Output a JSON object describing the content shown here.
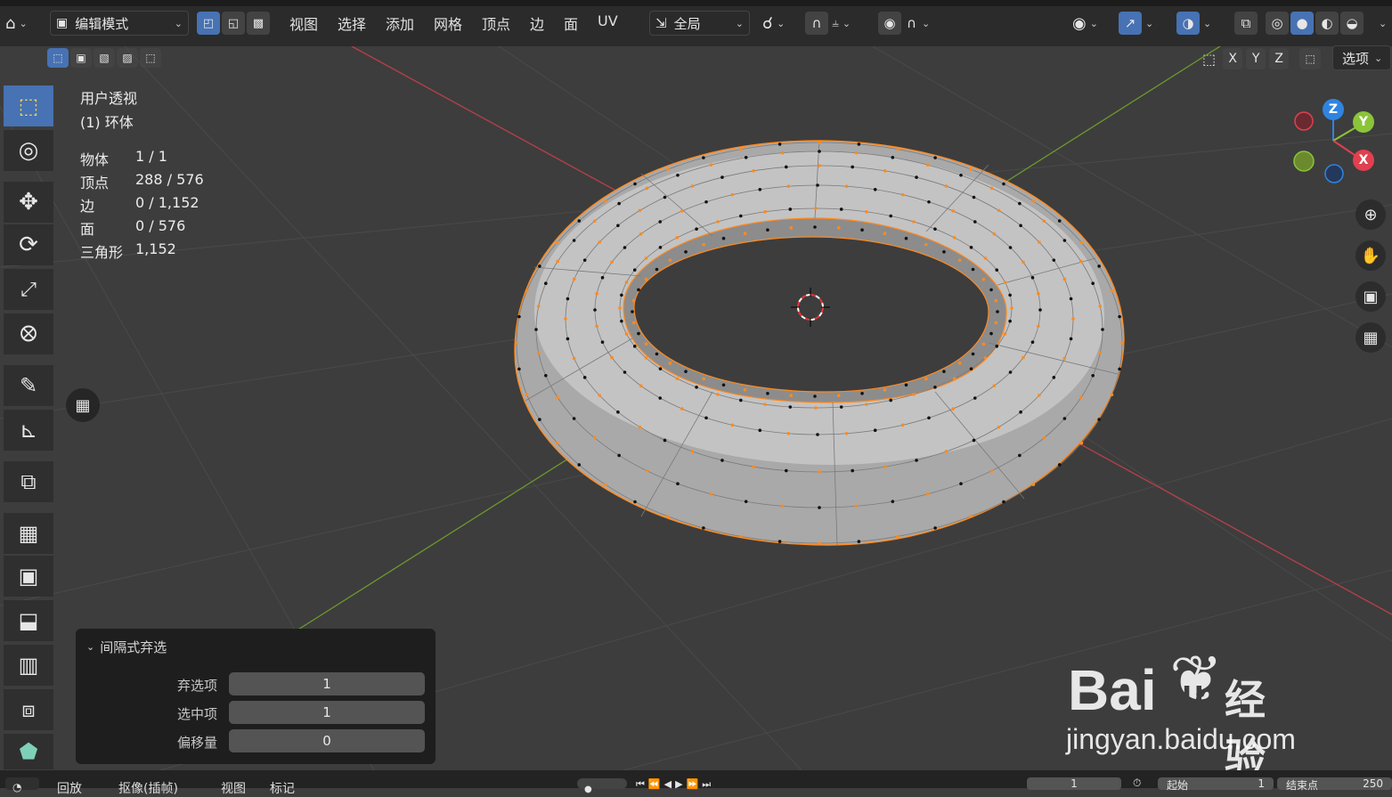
{
  "header": {
    "mode_label": "编辑模式",
    "menus": [
      "视图",
      "选择",
      "添加",
      "网格",
      "顶点",
      "边",
      "面",
      "UV"
    ],
    "transform_orientation": "全局",
    "axis_labels": [
      "X",
      "Y",
      "Z"
    ],
    "options_label": "选项"
  },
  "viewport": {
    "view_name": "用户透视",
    "object_name": "(1) 环体",
    "stats": [
      {
        "label": "物体",
        "value": "1 / 1"
      },
      {
        "label": "顶点",
        "value": "288 / 576"
      },
      {
        "label": "边",
        "value": "0 / 1,152"
      },
      {
        "label": "面",
        "value": "0 / 576"
      },
      {
        "label": "三角形",
        "value": "1,152"
      }
    ],
    "gizmo": {
      "x": "X",
      "y": "Y",
      "z": "Z"
    }
  },
  "operator_panel": {
    "title": "间隔式弃选",
    "rows": [
      {
        "label": "弃选项",
        "value": "1"
      },
      {
        "label": "选中项",
        "value": "1"
      },
      {
        "label": "偏移量",
        "value": "0"
      }
    ]
  },
  "bottom": {
    "items": [
      "回放",
      "抠像(插帧)",
      "视图",
      "标记"
    ],
    "current_frame": "1",
    "start_label": "起始",
    "start_value": "1",
    "end_label": "结束点",
    "end_value": "250"
  },
  "watermark": {
    "brand": "Bai",
    "brand2": "du",
    "product": "经验",
    "url": "jingyan.baidu.com"
  },
  "colors": {
    "accent": "#4772b3",
    "select": "#ff8a1f",
    "axis_x": "#e0404f",
    "axis_y": "#8bc43a",
    "axis_z": "#2f84e0"
  }
}
